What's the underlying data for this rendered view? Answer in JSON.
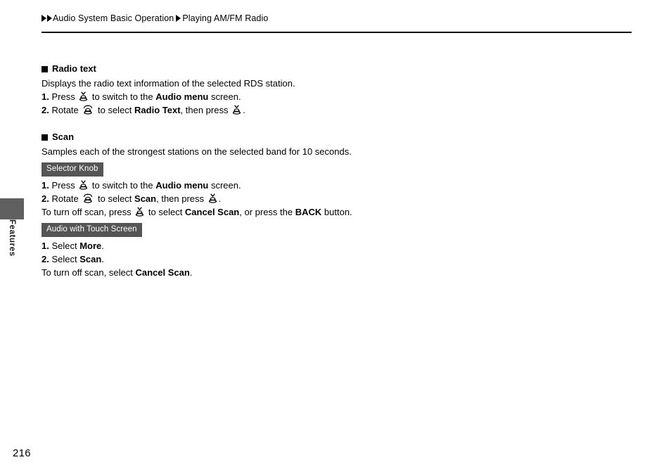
{
  "header": {
    "breadcrumb": [
      {
        "label": "Audio System Basic Operation"
      },
      {
        "label": "Playing AM/FM Radio"
      }
    ]
  },
  "side_tab": {
    "label": "Features",
    "color": "#606060"
  },
  "sections": [
    {
      "heading": "Radio text",
      "description": "Displays the radio text information of the selected RDS station.",
      "steps": [
        {
          "num": "1.",
          "parts": [
            {
              "type": "text",
              "value": "Press "
            },
            {
              "type": "icon",
              "value": "press-knob-icon"
            },
            {
              "type": "text",
              "value": " to switch to the "
            },
            {
              "type": "bold",
              "value": "Audio menu"
            },
            {
              "type": "text",
              "value": " screen."
            }
          ]
        },
        {
          "num": "2.",
          "parts": [
            {
              "type": "text",
              "value": "Rotate "
            },
            {
              "type": "icon",
              "value": "rotate-knob-icon"
            },
            {
              "type": "text",
              "value": " to select "
            },
            {
              "type": "bold",
              "value": "Radio Text"
            },
            {
              "type": "text",
              "value": ", then press "
            },
            {
              "type": "icon",
              "value": "press-knob-icon"
            },
            {
              "type": "text",
              "value": "."
            }
          ]
        }
      ]
    },
    {
      "heading": "Scan",
      "description": "Samples each of the strongest stations on the selected band for 10 seconds.",
      "groups": [
        {
          "badge": "Selector Knob",
          "steps": [
            {
              "num": "1.",
              "parts": [
                {
                  "type": "text",
                  "value": "Press "
                },
                {
                  "type": "icon",
                  "value": "press-knob-icon"
                },
                {
                  "type": "text",
                  "value": " to switch to the "
                },
                {
                  "type": "bold",
                  "value": "Audio menu"
                },
                {
                  "type": "text",
                  "value": " screen."
                }
              ]
            },
            {
              "num": "2.",
              "parts": [
                {
                  "type": "text",
                  "value": "Rotate "
                },
                {
                  "type": "icon",
                  "value": "rotate-knob-icon"
                },
                {
                  "type": "text",
                  "value": " to select "
                },
                {
                  "type": "bold",
                  "value": "Scan"
                },
                {
                  "type": "text",
                  "value": ", then press "
                },
                {
                  "type": "icon",
                  "value": "press-knob-icon"
                },
                {
                  "type": "text",
                  "value": "."
                }
              ]
            },
            {
              "num": "",
              "parts": [
                {
                  "type": "text",
                  "value": "To turn off scan, press "
                },
                {
                  "type": "icon",
                  "value": "press-knob-icon"
                },
                {
                  "type": "text",
                  "value": " to select "
                },
                {
                  "type": "bold",
                  "value": "Cancel Scan"
                },
                {
                  "type": "text",
                  "value": ", or press the "
                },
                {
                  "type": "bold",
                  "value": "BACK"
                },
                {
                  "type": "text",
                  "value": " button."
                }
              ]
            }
          ]
        },
        {
          "badge": "Audio with Touch Screen",
          "steps": [
            {
              "num": "1.",
              "parts": [
                {
                  "type": "text",
                  "value": "Select "
                },
                {
                  "type": "bold",
                  "value": "More"
                },
                {
                  "type": "text",
                  "value": "."
                }
              ]
            },
            {
              "num": "2.",
              "parts": [
                {
                  "type": "text",
                  "value": "Select "
                },
                {
                  "type": "bold",
                  "value": "Scan"
                },
                {
                  "type": "text",
                  "value": "."
                }
              ]
            },
            {
              "num": "",
              "parts": [
                {
                  "type": "text",
                  "value": "To turn off scan, select "
                },
                {
                  "type": "bold",
                  "value": "Cancel Scan"
                },
                {
                  "type": "text",
                  "value": "."
                }
              ]
            }
          ]
        }
      ]
    }
  ],
  "footer": {
    "page_number": "216"
  }
}
